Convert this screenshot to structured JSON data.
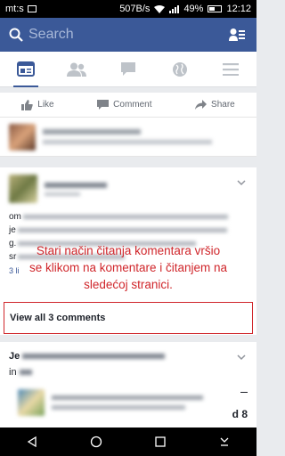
{
  "status_bar": {
    "left_text": "mt:s",
    "speed": "507B/s",
    "battery": "49%",
    "time": "12:12"
  },
  "header": {
    "search_placeholder": "Search",
    "icons": [
      "search-icon",
      "contacts-icon"
    ]
  },
  "nav": {
    "items": [
      "news-feed-icon",
      "friends-icon",
      "messages-icon",
      "globe-icon",
      "menu-icon"
    ],
    "active": "news-feed-icon"
  },
  "actions": {
    "like": "Like",
    "comment": "Comment",
    "share": "Share"
  },
  "main_post": {
    "text_lines": [
      "om",
      "je",
      "g.",
      "sr"
    ],
    "count_fragment": "3 li"
  },
  "annotation": {
    "line1": "Stari način čitanja komentara vršio",
    "line2": "se klikom na komentare i čitanjem na",
    "line3": "sledećoj stranici."
  },
  "view_comments": {
    "label": "View all 3 comments"
  },
  "post2": {
    "author_prefix": "Je",
    "in_label": "in",
    "trailing": "d 8",
    "dash": "–"
  },
  "colors": {
    "brand": "#3b5998",
    "annotation_red": "#d0262b"
  }
}
